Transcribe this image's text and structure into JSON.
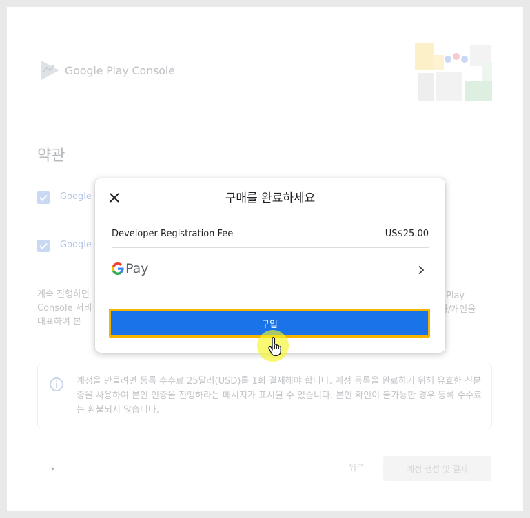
{
  "background": {
    "brand": "Google Play Console",
    "terms_title": "약관",
    "checkbox_1_label": "Google",
    "checkbox_2_label": "Google",
    "para_left_1": "계속 진행하면",
    "para_left_2": "Console 서비",
    "para_left_3": "대표하여 본",
    "para_right_1": "Play",
    "para_right_2": "사/개인을",
    "info_text": "계정을 만들려면 등록 수수료 25달러(USD)를 1회 결제해야 합니다. 계정 등록을 완료하기 위해 유효한 신분증을 사용하여 본인 인증을 진행하라는 메시지가 표시될 수 있습니다. 본인 확인이 불가능한 경우 등록 수수료는 환불되지 않습니다.",
    "back_label": "뒤로",
    "create_pay_label": "계정 생성 및 결제"
  },
  "modal": {
    "title": "구매를 완료하세요",
    "item_label": "Developer Registration Fee",
    "item_amount": "US$25.00",
    "payment_method": "Pay",
    "buy_label": "구입"
  },
  "colors": {
    "accent": "#1a73e8",
    "highlight": "#f5b400",
    "cursor_halo": "#f4f428"
  },
  "icons": [
    "close-icon",
    "google-g-icon",
    "chevron-right-icon",
    "info-icon",
    "checkbox-checked-icon",
    "hand-pointer-icon",
    "play-console-logo"
  ]
}
